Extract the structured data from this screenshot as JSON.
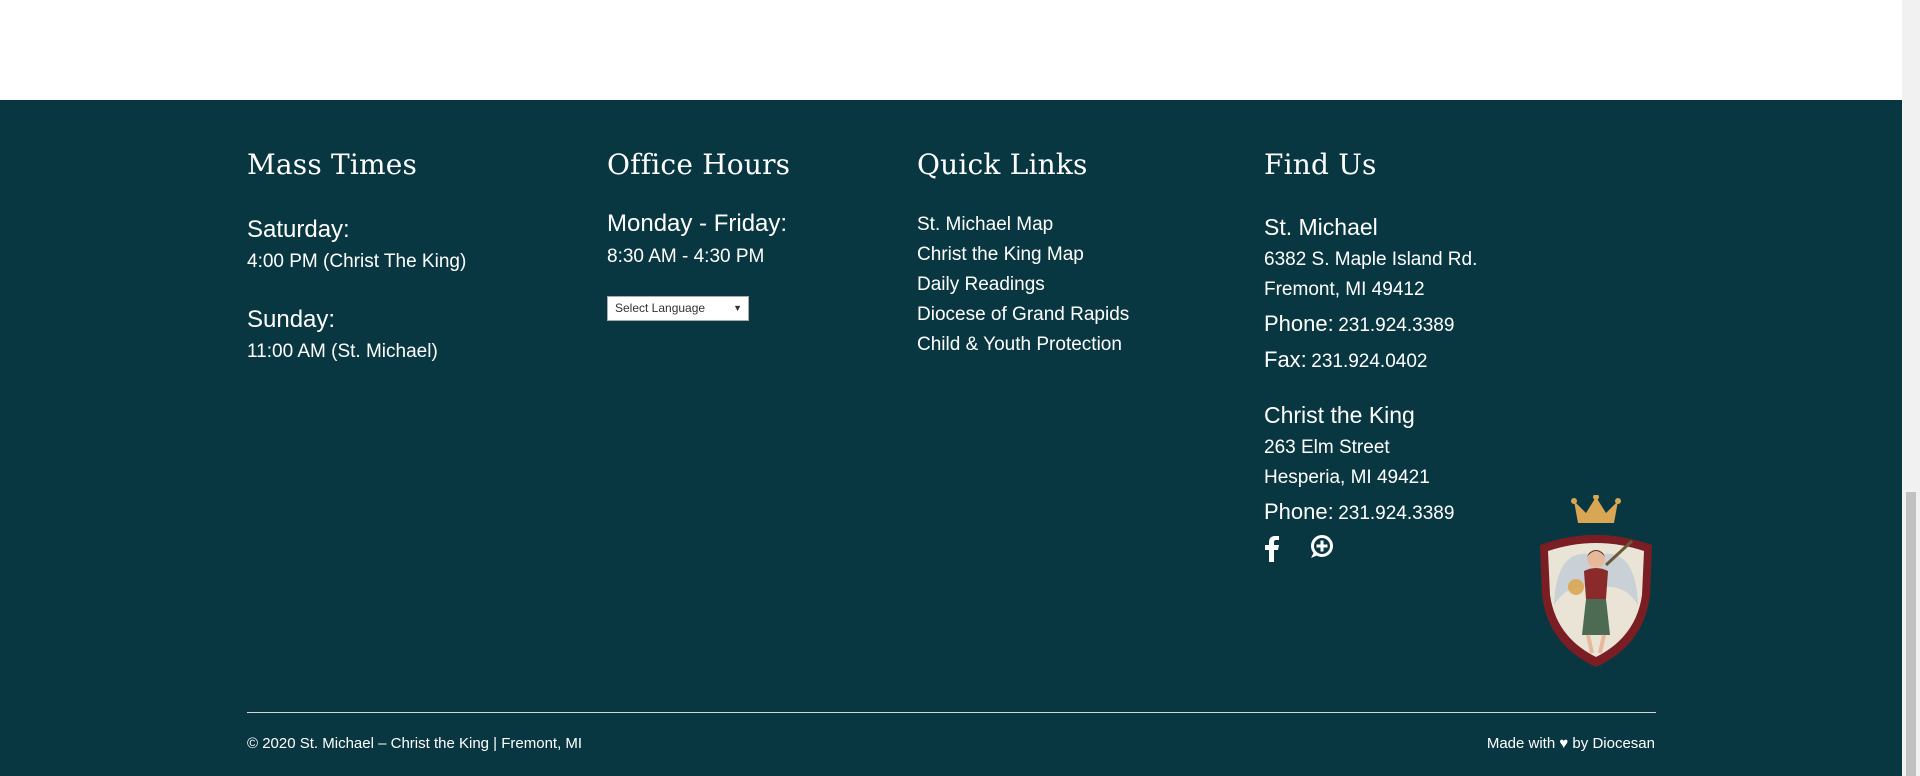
{
  "mass_times": {
    "title": "Mass Times",
    "saturday_label": "Saturday:",
    "saturday_time": "4:00 PM (Christ The King)",
    "sunday_label": "Sunday:",
    "sunday_time": "11:00 AM (St. Michael)"
  },
  "office_hours": {
    "title": "Office Hours",
    "days": "Monday - Friday:",
    "hours": "8:30 AM - 4:30 PM",
    "language_select": "Select Language"
  },
  "quick_links": {
    "title": "Quick Links",
    "items": [
      {
        "label": "St. Michael Map"
      },
      {
        "label": "Christ the King Map"
      },
      {
        "label": "Daily Readings"
      },
      {
        "label": "Diocese of Grand Rapids"
      },
      {
        "label": "Child & Youth Protection"
      }
    ]
  },
  "find_us": {
    "title": "Find Us",
    "st_michael": {
      "name": "St. Michael",
      "address1": "6382 S. Maple Island Rd.",
      "address2": "Fremont, MI 49412",
      "phone_label": "Phone:",
      "phone": "231.924.3389",
      "fax_label": "Fax:",
      "fax": "231.924.0402"
    },
    "christ_the_king": {
      "name": "Christ the King",
      "address1": "263 Elm Street",
      "address2": "Hesperia, MI 49421",
      "phone_label": "Phone:",
      "phone": "231.924.3389"
    },
    "social": [
      "facebook-icon",
      "flocknote-icon"
    ]
  },
  "footer_bottom": {
    "copyright": "© 2020 St. Michael – Christ the King | Fremont, MI",
    "made_with_prefix": "Made with ♥ by ",
    "made_with_link": "Diocesan"
  },
  "colors": {
    "footer_bg": "#093741",
    "text": "#ffffff",
    "crest_crown": "#d9a653",
    "crest_shield": "#7a1e24"
  }
}
